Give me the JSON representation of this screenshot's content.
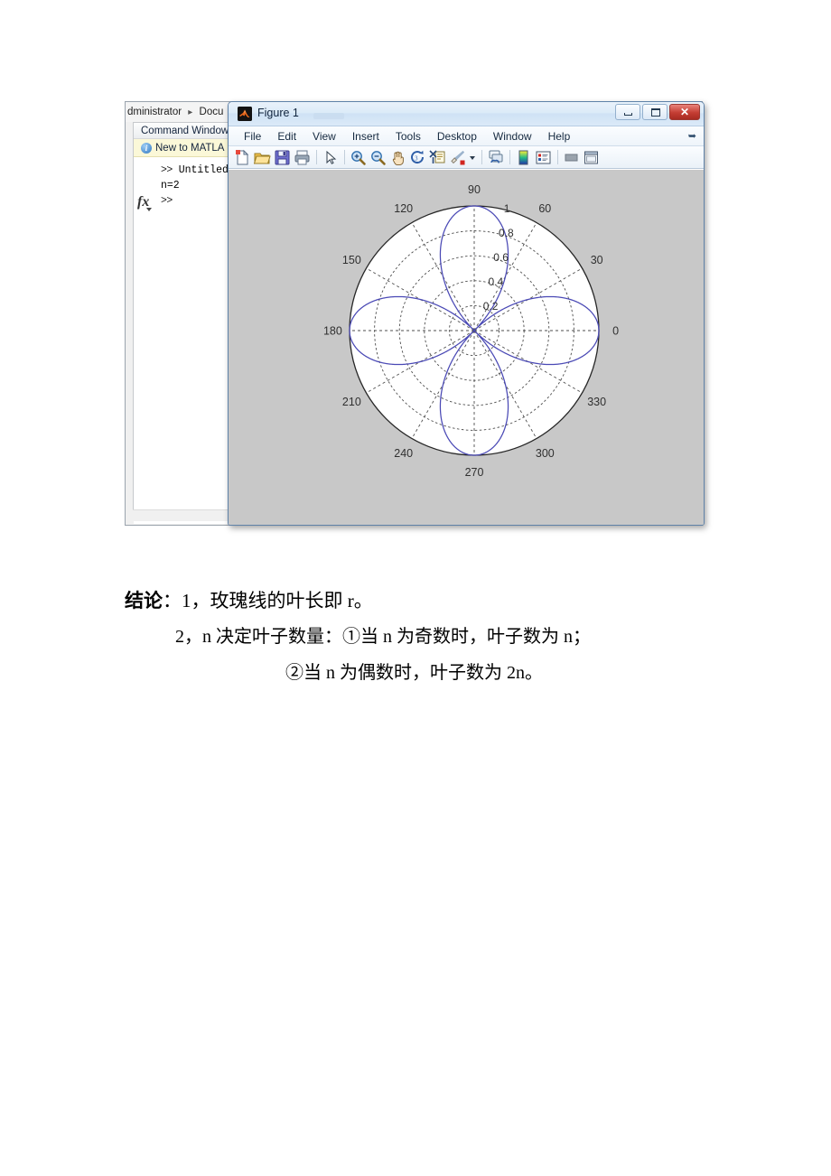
{
  "matlab_desktop": {
    "address_left": "dministrator",
    "address_right": "Docu",
    "address_separator": "▸",
    "command_window_title": "Command Window",
    "banner_text": "New to MATLA",
    "banner_icon": "info-icon",
    "console_lines": [
      {
        "prompt": ">>",
        "text": "Untitled"
      },
      {
        "prompt": "",
        "text": "n=2"
      },
      {
        "prompt": ">>",
        "text": ""
      }
    ],
    "fx_label": "fx"
  },
  "figure_window": {
    "title": "Figure 1",
    "logo_icon": "matlab-logo-icon",
    "window_buttons": [
      {
        "name": "minimize-button",
        "glyph": "—"
      },
      {
        "name": "maximize-button",
        "glyph": "□"
      },
      {
        "name": "close-button",
        "glyph": "✕"
      }
    ],
    "menus": [
      "File",
      "Edit",
      "View",
      "Insert",
      "Tools",
      "Desktop",
      "Window",
      "Help"
    ],
    "menu_overflow_icon": "chevron-overflow-icon",
    "toolbar": [
      {
        "name": "new-figure-icon",
        "tip": "New Figure"
      },
      {
        "name": "open-file-icon",
        "tip": "Open File"
      },
      {
        "name": "save-figure-icon",
        "tip": "Save Figure"
      },
      {
        "name": "print-figure-icon",
        "tip": "Print Figure"
      },
      {
        "name": "separator"
      },
      {
        "name": "pointer-select-icon",
        "tip": "Edit Plot"
      },
      {
        "name": "separator"
      },
      {
        "name": "zoom-in-icon",
        "tip": "Zoom In"
      },
      {
        "name": "zoom-out-icon",
        "tip": "Zoom Out"
      },
      {
        "name": "pan-icon",
        "tip": "Pan"
      },
      {
        "name": "rotate-3d-icon",
        "tip": "Rotate 3D"
      },
      {
        "name": "data-cursor-icon",
        "tip": "Data Cursor"
      },
      {
        "name": "brush-icon",
        "tip": "Brush/Select Data"
      },
      {
        "name": "brush-caret-icon"
      },
      {
        "name": "separator"
      },
      {
        "name": "link-plot-icon",
        "tip": "Link Plot"
      },
      {
        "name": "separator"
      },
      {
        "name": "colorbar-icon",
        "tip": "Insert Colorbar"
      },
      {
        "name": "legend-icon",
        "tip": "Insert Legend"
      },
      {
        "name": "separator"
      },
      {
        "name": "hide-plot-tools-icon",
        "tip": "Hide Plot Tools"
      },
      {
        "name": "show-plot-tools-icon",
        "tip": "Show Plot Tools"
      }
    ]
  },
  "chart_data": {
    "type": "line",
    "subtype": "polar",
    "title": "",
    "xlabel": "",
    "ylabel": "",
    "equation": "r = |sin(2θ)|",
    "n": 2,
    "petals": 4,
    "petal_angles_deg": [
      0,
      90,
      180,
      270
    ],
    "rlim": [
      0,
      1
    ],
    "r_ticks": [
      0.2,
      0.4,
      0.6,
      0.8,
      1
    ],
    "r_tick_labels": [
      "0.2",
      "0.4",
      "0.6",
      "0.8",
      "1"
    ],
    "theta_ticks_deg": [
      0,
      30,
      60,
      90,
      120,
      150,
      180,
      210,
      240,
      270,
      300,
      330
    ],
    "theta_tick_labels": [
      "0",
      "30",
      "60",
      "90",
      "120",
      "150",
      "180",
      "210",
      "240",
      "270",
      "300",
      "330"
    ],
    "grid": true,
    "grid_style": "dashed",
    "legend": null,
    "line_color": "#4a49b5",
    "axes_background": "#ffffff",
    "figure_background": "#c8c8c8"
  },
  "conclusion": {
    "label": "结论",
    "colon": "：",
    "line1": "1，玫瑰线的叶长即 r。",
    "line2": "2，n 决定叶子数量：①当 n 为奇数时，叶子数为 n；",
    "line3": "②当 n 为偶数时，叶子数为 2n。"
  }
}
